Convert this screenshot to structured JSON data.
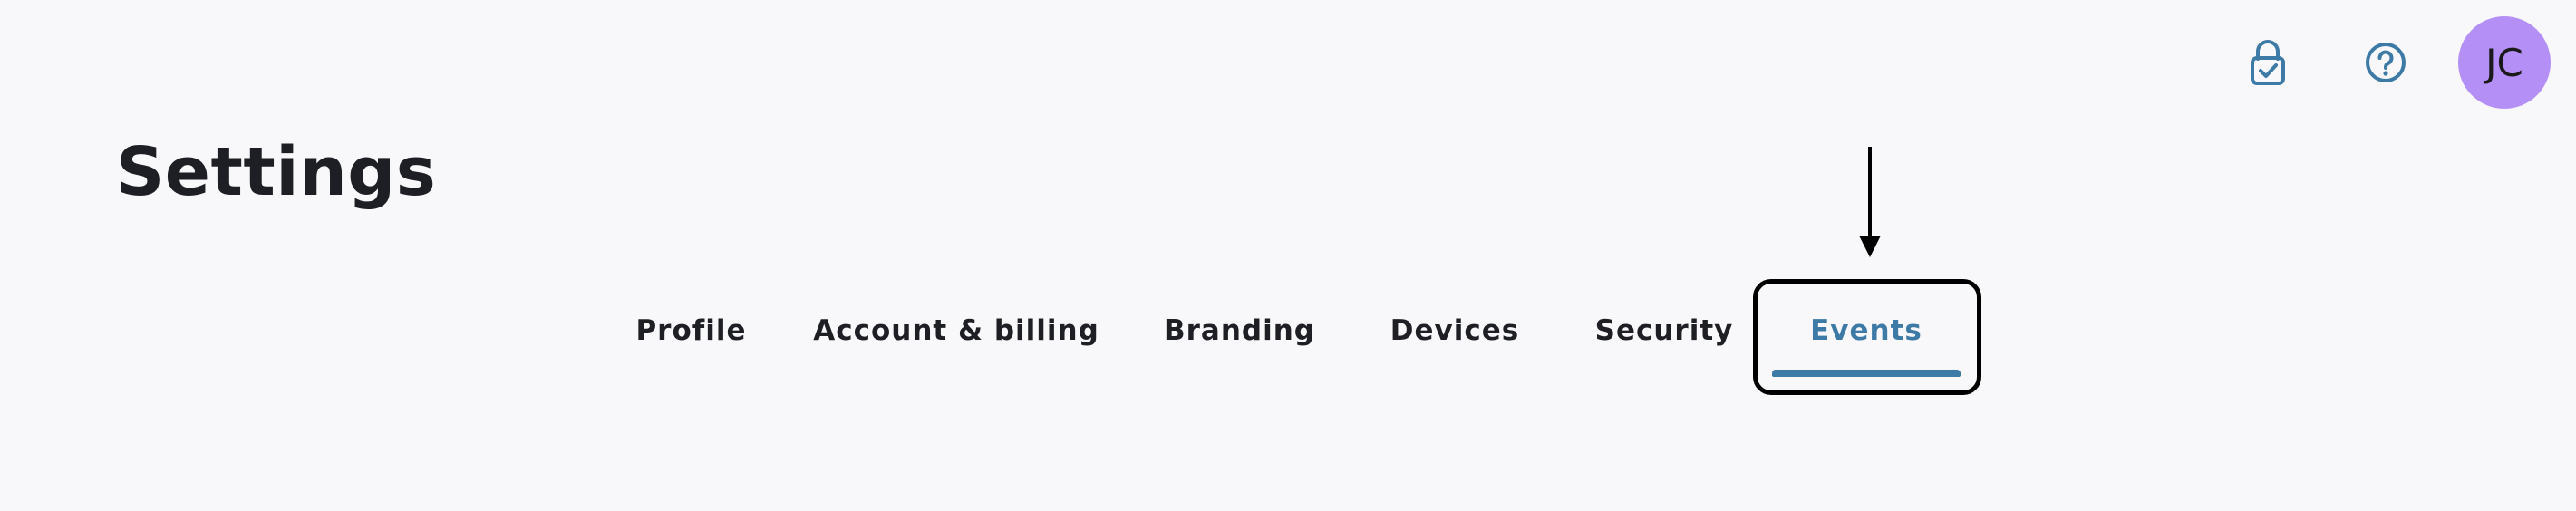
{
  "header": {
    "icons": [
      {
        "name": "lock-check-icon",
        "color": "#3d7aa6"
      },
      {
        "name": "help-circle-icon",
        "color": "#3d7aa6"
      }
    ],
    "avatar": {
      "initials": "JC",
      "background": "#b48ff5"
    }
  },
  "page": {
    "title": "Settings"
  },
  "tabs": [
    {
      "label": "Profile"
    },
    {
      "label": "Account & billing"
    },
    {
      "label": "Branding"
    },
    {
      "label": "Devices"
    },
    {
      "label": "Security"
    },
    {
      "label": "Events",
      "active": true
    }
  ],
  "colors": {
    "accent": "#3d7aa6",
    "text": "#1e1f24",
    "background": "#f8f8fa",
    "annotation": "#000000"
  }
}
